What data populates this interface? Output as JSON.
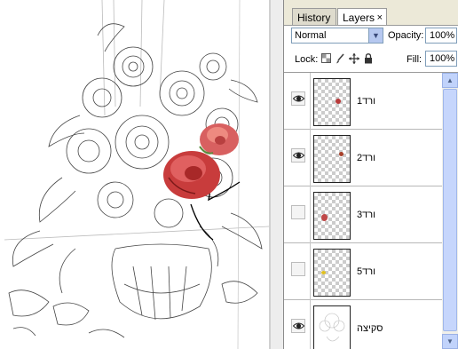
{
  "tabs": [
    {
      "label": "History",
      "active": false
    },
    {
      "label": "Layers",
      "active": true,
      "close": "×"
    }
  ],
  "options": {
    "blend_mode": "Normal",
    "opacity_label": "Opacity:",
    "opacity_value": "100%",
    "lock_label": "Lock:",
    "lock_icons": [
      "lock-transparent-icon",
      "lock-brush-icon",
      "lock-move-icon",
      "lock-all-icon"
    ],
    "fill_label": "Fill:",
    "fill_value": "100%"
  },
  "layers": [
    {
      "name": "ורד1",
      "visible": true,
      "thumb_color": "#b83a3a"
    },
    {
      "name": "ורד2",
      "visible": true,
      "thumb_color": "#a8402a"
    },
    {
      "name": "ורד3",
      "visible": false,
      "thumb_color": "#c04848"
    },
    {
      "name": "ורד5",
      "visible": false,
      "thumb_color": "#e0c020"
    },
    {
      "name": "סקיצה",
      "visible": true,
      "thumb_color": "#d8d8d8"
    }
  ],
  "icons": {
    "eye": "eye-icon",
    "dropdown": "chevron-down-icon",
    "scroll_up": "arrow-up-icon",
    "scroll_down": "arrow-down-icon"
  },
  "colors": {
    "panel_bg": "#ece9d8",
    "accent_scroll": "#c1d3fb",
    "rose": "#c83c3c"
  }
}
